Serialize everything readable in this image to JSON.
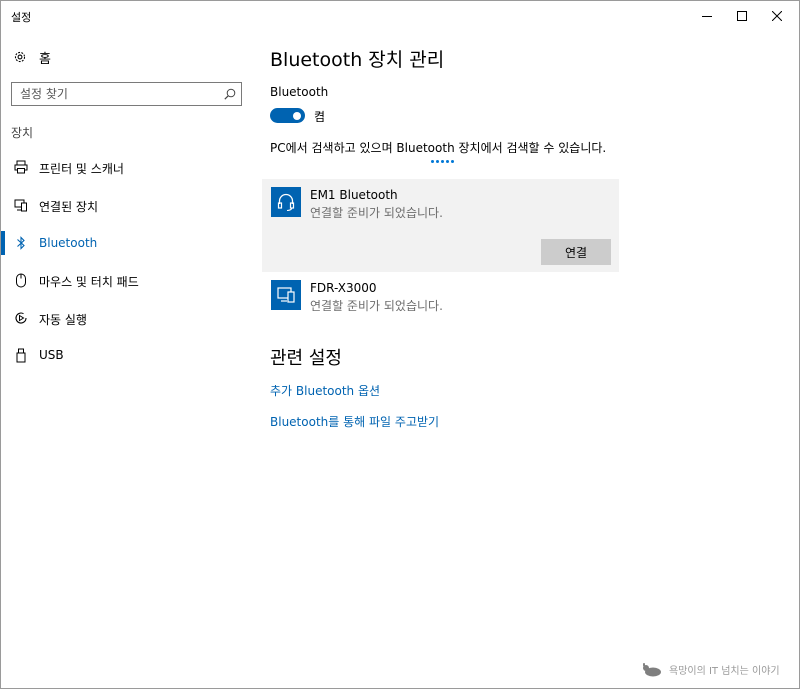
{
  "window": {
    "title": "설정",
    "controls": {
      "minimize": "minimize-icon",
      "maximize": "maximize-icon",
      "close": "close-icon"
    }
  },
  "sidebar": {
    "home_label": "홈",
    "search_placeholder": "설정 찾기",
    "section_label": "장치",
    "items": [
      {
        "label": "프린터 및 스캐너",
        "icon": "printer-icon"
      },
      {
        "label": "연결된 장치",
        "icon": "connected-devices-icon"
      },
      {
        "label": "Bluetooth",
        "icon": "bluetooth-icon",
        "active": true
      },
      {
        "label": "마우스 및 터치 패드",
        "icon": "mouse-icon"
      },
      {
        "label": "자동 실행",
        "icon": "autoplay-icon"
      },
      {
        "label": "USB",
        "icon": "usb-icon"
      }
    ]
  },
  "main": {
    "title": "Bluetooth 장치 관리",
    "bluetooth_label": "Bluetooth",
    "toggle_state": "켬",
    "toggle_on": true,
    "discover_text": "PC에서 검색하고 있으며 Bluetooth 장치에서 검색할 수 있습니다.",
    "devices": [
      {
        "name": "EM1 Bluetooth",
        "status": "연결할 준비가 되었습니다.",
        "icon": "headset-icon",
        "selected": true,
        "button": "연결"
      },
      {
        "name": "FDR-X3000",
        "status": "연결할 준비가 되었습니다.",
        "icon": "device-icon",
        "selected": false
      }
    ],
    "related_title": "관련 설정",
    "links": [
      {
        "label": "추가 Bluetooth 옵션"
      },
      {
        "label": "Bluetooth를 통해 파일 주고받기"
      }
    ]
  },
  "watermark": {
    "text": "욕망이의 IT 넘치는 이야기"
  },
  "colors": {
    "accent": "#0063b1",
    "selected_bg": "#f2f2f2",
    "button_bg": "#cccccc"
  }
}
